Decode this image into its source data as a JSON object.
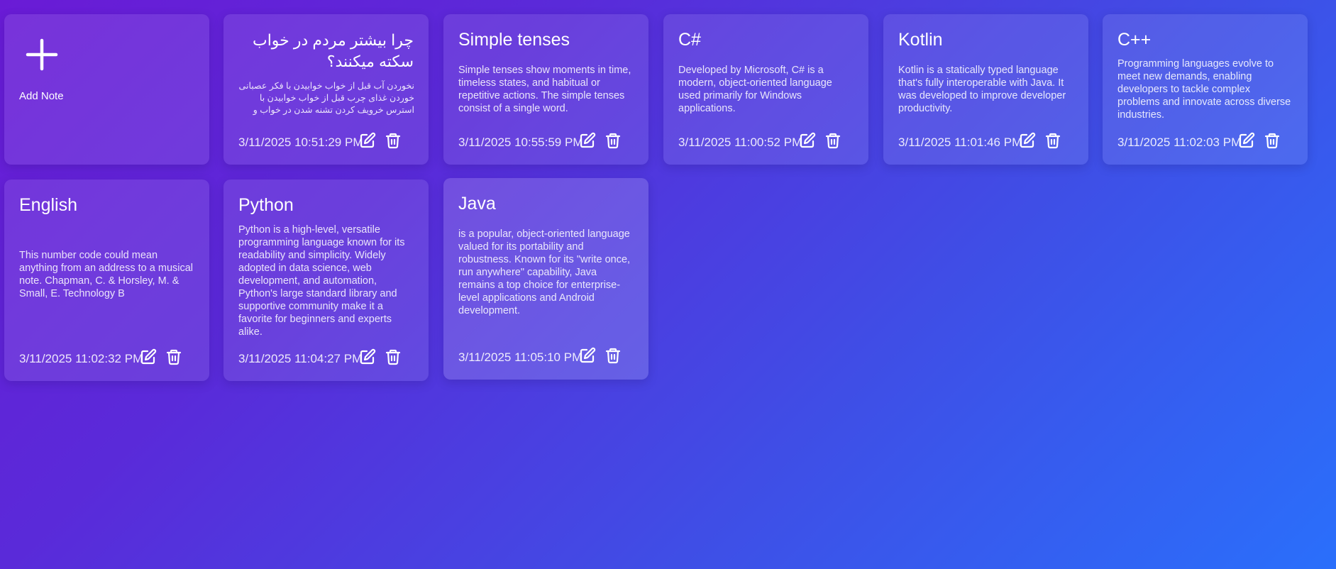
{
  "add_note": {
    "label": "Add Note"
  },
  "notes": [
    {
      "title": "چرا بیشتر مردم در خواب سکته میکنند؟",
      "body": "نخوردن آب قبل از خواب خوابیدن با فکر عصبانی خوردن غذای چرب قبل از خواب خوابیدن با استرس خرویف کردن تشنه شدن در خواب و نخوردن آب",
      "date": "3/11/2025 10:51:29 PM"
    },
    {
      "title": "Simple tenses",
      "body": "Simple tenses show moments in time, timeless states, and habitual or repetitive actions. The simple tenses consist of a single word.",
      "date": "3/11/2025 10:55:59 PM"
    },
    {
      "title": "C#",
      "body": "Developed by Microsoft, C# is a modern, object-oriented language used primarily for Windows applications.",
      "date": "3/11/2025 11:00:52 PM"
    },
    {
      "title": "Kotlin",
      "body": "Kotlin is a statically typed language that's fully interoperable with Java. It was developed to improve developer productivity.",
      "date": "3/11/2025 11:01:46 PM"
    },
    {
      "title": "C++",
      "body": "Programming languages evolve to meet new demands, enabling developers to tackle complex problems and innovate across diverse industries.",
      "date": "3/11/2025 11:02:03 PM"
    },
    {
      "title": "English",
      "body": "This number code could mean anything from an address to a musical note. Chapman, C. & Horsley, M. & Small, E. Technology B",
      "date": "3/11/2025 11:02:32 PM"
    },
    {
      "title": "Python",
      "body": "Python is a high-level, versatile programming language known for its readability and simplicity. Widely adopted in data science, web development, and automation, Python's large standard library and supportive community make it a favorite for beginners and experts alike.",
      "date": "3/11/2025 11:04:27 PM"
    },
    {
      "title": "Java",
      "body": "is a popular, object-oriented language valued for its portability and robustness. Known for its \"write once, run anywhere\" capability, Java remains a top choice for enterprise-level applications and Android development.",
      "date": "3/11/2025 11:05:10 PM"
    }
  ],
  "icons": {
    "add": "plus-icon",
    "edit": "edit-icon",
    "delete": "trash-icon"
  },
  "colors": {
    "gradient_start": "#6a1bd6",
    "gradient_end": "#2a6ffb"
  }
}
